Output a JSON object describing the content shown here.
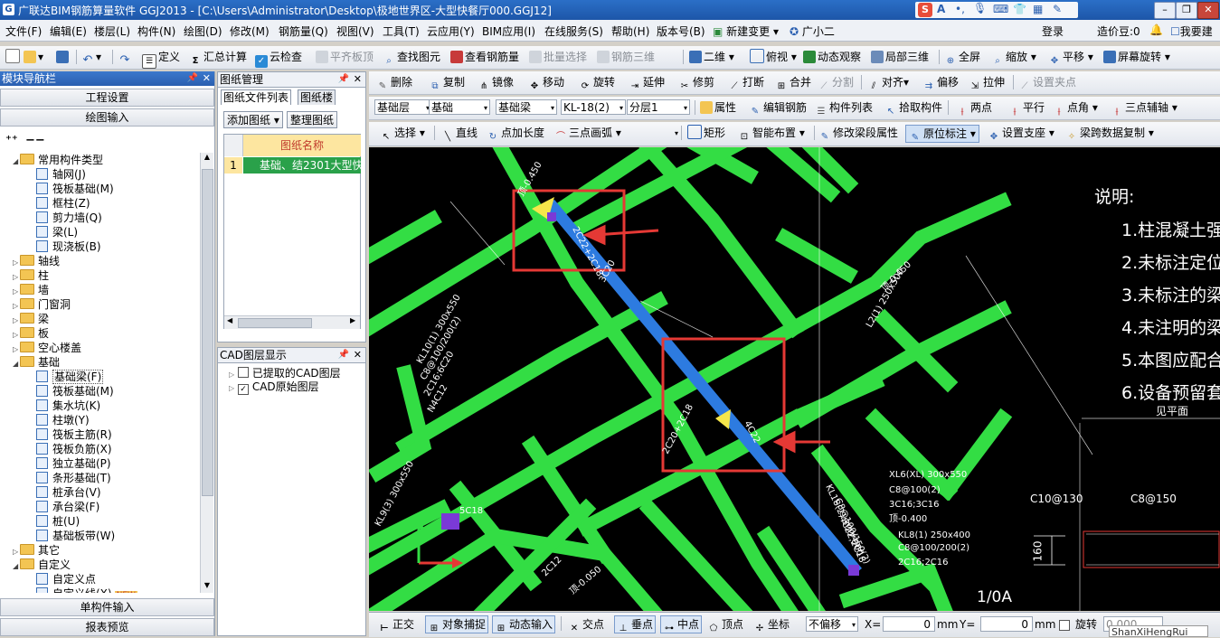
{
  "window": {
    "title": "广联达BIM钢筋算量软件 GGJ2013 - [C:\\Users\\Administrator\\Desktop\\极地世界区-大型快餐厅000.GGJ12]",
    "minimize": "–",
    "restore": "❐",
    "close": "✕"
  },
  "menu": [
    "文件(F)",
    "编辑(E)",
    "楼层(L)",
    "构件(N)",
    "绘图(D)",
    "修改(M)",
    "钢筋量(Q)",
    "视图(V)",
    "工具(T)",
    "云应用(Y)",
    "BIM应用(I)",
    "在线服务(S)",
    "帮助(H)",
    "版本号(B)",
    "新建变更",
    "广小二"
  ],
  "menu_right": {
    "login": "登录",
    "price": "造价豆:0",
    "suggest": "我要建"
  },
  "toolbar1": {
    "define": "定义",
    "sum": "汇总计算",
    "cloud_check": "云检查",
    "align_top": "平齐板顶",
    "find": "查找图元",
    "view_rebar": "查看钢筋量",
    "batch": "批量选择",
    "rebar3d": "钢筋三维",
    "view2d": "二维",
    "top_view": "俯视",
    "dynamic": "动态观察",
    "local3d": "局部三维",
    "fullscreen": "全屏",
    "zoom": "缩放",
    "pan": "平移",
    "rotate": "屏幕旋转"
  },
  "toolbar2": {
    "delete": "删除",
    "copy": "复制",
    "mirror": "镜像",
    "move": "移动",
    "rotate": "旋转",
    "extend": "延伸",
    "trim": "修剪",
    "break": "打断",
    "merge": "合并",
    "split": "分割",
    "align": "对齐",
    "offset": "偏移",
    "stretch": "拉伸",
    "set_point": "设置夹点"
  },
  "toolbar3": {
    "floor": "基础层",
    "category": "基础",
    "type": "基础梁",
    "member": "KL-18(2)",
    "layer": "分层1",
    "property": "属性",
    "edit_rebar": "编辑钢筋",
    "member_list": "构件列表",
    "pick": "拾取构件",
    "two_point": "两点",
    "parallel": "平行",
    "point_angle": "点角",
    "three_point_axis": "三点辅轴"
  },
  "toolbar4": {
    "select": "选择",
    "line": "直线",
    "point_len": "点加长度",
    "arc3": "三点画弧",
    "rect": "矩形",
    "smart": "智能布置",
    "modify_seg": "修改梁段属性",
    "in_place": "原位标注",
    "set_support": "设置支座",
    "beam_copy": "梁跨数据复制"
  },
  "nav": {
    "title": "模块导航栏",
    "project_settings": "工程设置",
    "drawing_input": "绘图输入",
    "single_input": "单构件输入",
    "report": "报表预览",
    "tree": [
      {
        "level": 0,
        "label": "常用构件类型",
        "expanded": true
      },
      {
        "level": 1,
        "label": "轴网(J)"
      },
      {
        "level": 1,
        "label": "筏板基础(M)"
      },
      {
        "level": 1,
        "label": "框柱(Z)"
      },
      {
        "level": 1,
        "label": "剪力墙(Q)"
      },
      {
        "level": 1,
        "label": "梁(L)"
      },
      {
        "level": 1,
        "label": "现浇板(B)"
      },
      {
        "level": 0,
        "label": "轴线"
      },
      {
        "level": 0,
        "label": "柱"
      },
      {
        "level": 0,
        "label": "墙"
      },
      {
        "level": 0,
        "label": "门窗洞"
      },
      {
        "level": 0,
        "label": "梁"
      },
      {
        "level": 0,
        "label": "板"
      },
      {
        "level": 0,
        "label": "空心楼盖"
      },
      {
        "level": 0,
        "label": "基础",
        "expanded": true
      },
      {
        "level": 1,
        "label": "基础梁(F)",
        "selected": true
      },
      {
        "level": 1,
        "label": "筏板基础(M)"
      },
      {
        "level": 1,
        "label": "集水坑(K)"
      },
      {
        "level": 1,
        "label": "柱墩(Y)"
      },
      {
        "level": 1,
        "label": "筏板主筋(R)"
      },
      {
        "level": 1,
        "label": "筏板负筋(X)"
      },
      {
        "level": 1,
        "label": "独立基础(P)"
      },
      {
        "level": 1,
        "label": "条形基础(T)"
      },
      {
        "level": 1,
        "label": "桩承台(V)"
      },
      {
        "level": 1,
        "label": "承台梁(F)"
      },
      {
        "level": 1,
        "label": "桩(U)"
      },
      {
        "level": 1,
        "label": "基础板带(W)"
      },
      {
        "level": 0,
        "label": "其它"
      },
      {
        "level": 0,
        "label": "自定义",
        "expanded": true
      },
      {
        "level": 1,
        "label": "自定义点"
      },
      {
        "level": 1,
        "label": "自定义线(X)",
        "badge": "NEW"
      }
    ]
  },
  "drawing_manager": {
    "title": "图纸管理",
    "tab_files": "图纸文件列表",
    "tab_layers": "图纸楼",
    "add_drawing": "添加图纸",
    "organize": "整理图纸",
    "col_name": "图纸名称",
    "rows": [
      {
        "index": "1",
        "name": "基础、结2301大型快"
      }
    ]
  },
  "cad_layers": {
    "title": "CAD图层显示",
    "items": [
      {
        "label": "已提取的CAD图层",
        "checked": false
      },
      {
        "label": "CAD原始图层",
        "checked": true
      }
    ]
  },
  "canvas": {
    "notes_title": "说明:",
    "notes": [
      "1.柱混凝土强",
      "2.未标注定位",
      "3.未标注的梁",
      "4.未注明的梁",
      "5.本图应配合",
      "6.设备预留套"
    ],
    "see_plan": "见平面",
    "detail_labels": [
      "C10@130",
      "C8@150"
    ],
    "detail_dim": "160",
    "scale_label": "1/0A",
    "beam_labels": [
      "KL10(1) 300x550",
      "C8@100/200(2)",
      "2C16;6C20",
      "N4C12",
      "KL18(2) 300*800",
      "C8@100/150(2)",
      "4C22;2C18",
      "顶-0.450",
      "L2(1) 250x500",
      "XL6(XL) 300x550",
      "C8@100(2)",
      "3C16;3C16",
      "顶-0.400",
      "KL8(1) 250x400",
      "C8@100/200(2)",
      "2C16;2C16",
      "2C22+2C18",
      "4C22",
      "2C20+2C18",
      "3C20",
      "5C18",
      "2C12",
      "顶-0.050",
      "KL9(3) 300x550",
      "顶-0.450"
    ]
  },
  "statusbar": {
    "ortho": "正交",
    "snap": "对象捕捉",
    "dyn_input": "动态输入",
    "intersect": "交点",
    "perp": "垂点",
    "mid": "中点",
    "vertex": "顶点",
    "coord": "坐标",
    "offset_mode": "不偏移",
    "x_label": "X=",
    "x_value": "0",
    "x_unit": "mm",
    "y_label": "Y=",
    "y_value": "0",
    "y_unit": "mm",
    "rotate": "旋转",
    "rotate_value": "0.000",
    "watermark": "ShanXiHengRui"
  },
  "colors": {
    "beam_green": "#33dd44",
    "selected_beam": "#2d7be0",
    "highlight_box": "#e53935",
    "arrow": "#e53935",
    "title_blue": "#1d56a8"
  }
}
